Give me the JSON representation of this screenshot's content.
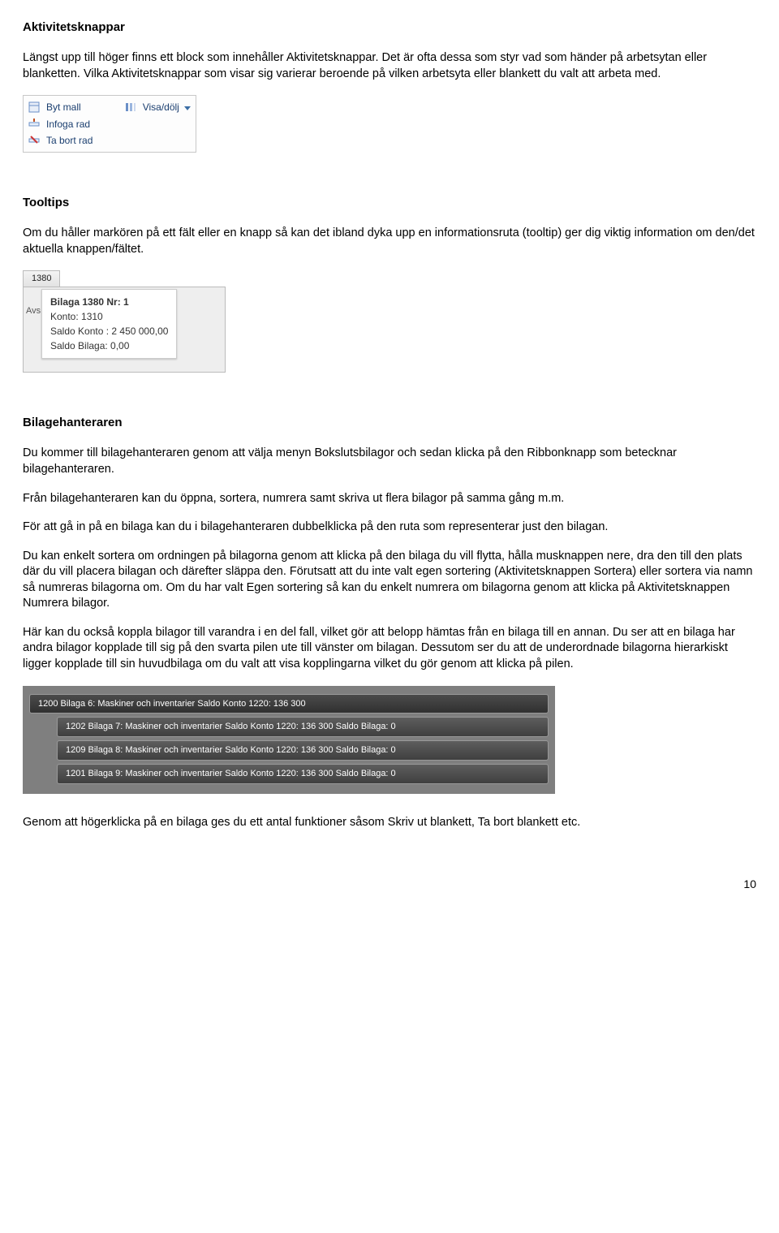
{
  "section1": {
    "title": "Aktivitetsknappar",
    "para": "Längst upp till höger finns ett block som innehåller Aktivitetsknappar. Det är ofta dessa som styr vad som händer på arbetsytan eller blanketten. Vilka Aktivitetsknappar som visar sig varierar beroende på vilken arbetsyta eller blankett du valt att arbeta med."
  },
  "toolbar": {
    "items": [
      {
        "label": "Byt mall"
      },
      {
        "label": "Visa/dölj"
      },
      {
        "label": "Infoga rad"
      },
      {
        "label": "Ta bort rad"
      }
    ]
  },
  "section2": {
    "title": "Tooltips",
    "para": "Om du håller markören på ett fält eller en knapp så kan det ibland dyka upp en informationsruta (tooltip) ger dig viktig information om den/det aktuella knappen/fältet."
  },
  "tooltip": {
    "tab": "1380",
    "side": "Avs",
    "lines": [
      "Bilaga 1380 Nr: 1",
      "Konto: 1310",
      "Saldo Konto : 2 450 000,00",
      "Saldo Bilaga: 0,00"
    ]
  },
  "section3": {
    "title": "Bilagehanteraren",
    "p1": "Du kommer till bilagehanteraren genom att välja menyn Bokslutsbilagor och sedan klicka på den Ribbonknapp som betecknar bilagehanteraren.",
    "p2": "Från bilagehanteraren kan du öppna, sortera, numrera samt skriva ut flera bilagor på samma gång m.m.",
    "p3": "För att gå in på en bilaga kan du i bilagehanteraren dubbelklicka på den ruta som representerar just den bilagan.",
    "p4": "Du kan enkelt sortera om ordningen på bilagorna genom att klicka på den bilaga du vill flytta, hålla musknappen nere, dra den till den plats där du vill placera bilagan och därefter släppa den. Förutsatt att du inte valt egen sortering (Aktivitetsknappen Sortera) eller sortera via namn så numreras bilagorna om. Om du har valt Egen sortering så kan du enkelt numrera om bilagorna genom att klicka på Aktivitetsknappen Numrera bilagor.",
    "p5": "Här kan du också koppla bilagor till varandra i en del fall, vilket gör att belopp hämtas från en bilaga till en annan. Du ser att en bilaga har andra bilagor kopplade till sig på den svarta pilen ute till vänster om bilagan. Dessutom ser du att de underordnade bilagorna hierarkiskt ligger kopplade till sin huvudbilaga om du valt att visa kopplingarna vilket du gör genom att klicka på pilen.",
    "p6": "Genom att högerklicka på en bilaga ges du ett antal funktioner såsom Skriv ut blankett, Ta bort blankett etc."
  },
  "bilagaTree": {
    "rows": [
      "1200 Bilaga 6: Maskiner och inventarier   Saldo Konto 1220: 136 300",
      "1202 Bilaga 7: Maskiner och inventarier   Saldo Konto 1220: 136 300   Saldo Bilaga: 0",
      "1209 Bilaga 8: Maskiner och inventarier   Saldo Konto 1220: 136 300   Saldo Bilaga: 0",
      "1201 Bilaga 9: Maskiner och inventarier   Saldo Konto 1220: 136 300   Saldo Bilaga: 0"
    ]
  },
  "pageNumber": "10"
}
